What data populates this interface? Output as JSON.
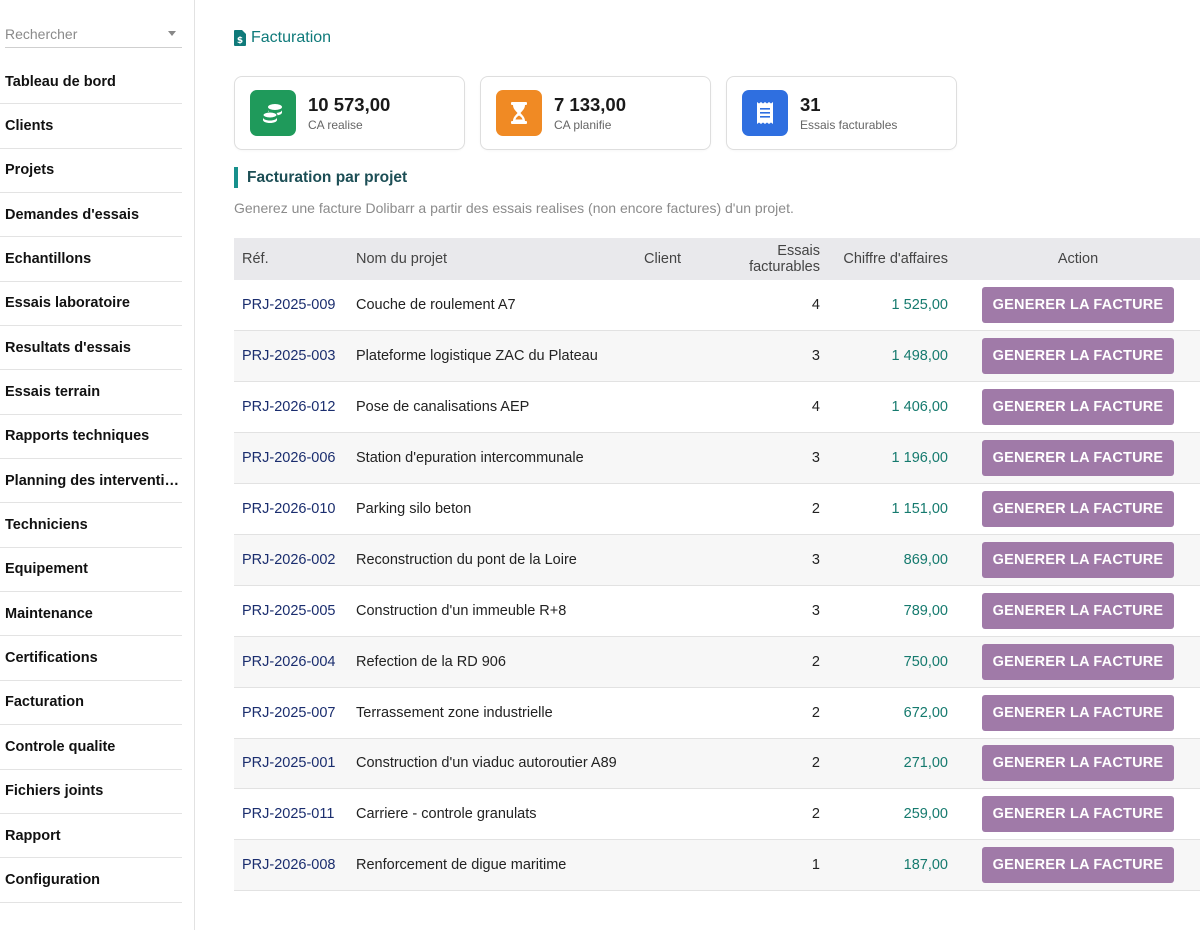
{
  "sidebar": {
    "search_placeholder": "Rechercher",
    "items": [
      {
        "label": "Tableau de bord"
      },
      {
        "label": "Clients"
      },
      {
        "label": "Projets"
      },
      {
        "label": "Demandes d'essais"
      },
      {
        "label": "Echantillons"
      },
      {
        "label": "Essais laboratoire"
      },
      {
        "label": "Resultats d'essais"
      },
      {
        "label": "Essais terrain"
      },
      {
        "label": "Rapports techniques"
      },
      {
        "label": "Planning des interventions"
      },
      {
        "label": "Techniciens"
      },
      {
        "label": "Equipement"
      },
      {
        "label": "Maintenance"
      },
      {
        "label": "Certifications"
      },
      {
        "label": "Facturation"
      },
      {
        "label": "Controle qualite"
      },
      {
        "label": "Fichiers joints"
      },
      {
        "label": "Rapport"
      },
      {
        "label": "Configuration"
      }
    ]
  },
  "header": {
    "title": "Facturation",
    "title_icon": "invoice-icon"
  },
  "cards": [
    {
      "value": "10 573,00",
      "label": "CA realise",
      "icon": "coins-icon",
      "color": "#1f9a5b"
    },
    {
      "value": "7 133,00",
      "label": "CA planifie",
      "icon": "hourglass-icon",
      "color": "#f08a24"
    },
    {
      "value": "31",
      "label": "Essais facturables",
      "icon": "receipt-icon",
      "color": "#2f6fe0"
    }
  ],
  "section": {
    "title": "Facturation par projet",
    "description": "Generez une facture Dolibarr a partir des essais realises (non encore factures) d'un projet."
  },
  "table": {
    "columns": {
      "ref": "Réf.",
      "name": "Nom du projet",
      "client": "Client",
      "count": "Essais facturables",
      "ca": "Chiffre d'affaires",
      "action": "Action"
    },
    "button_label": "GENERER LA FACTURE",
    "rows": [
      {
        "ref": "PRJ-2025-009",
        "name": "Couche de roulement A7",
        "client": "",
        "count": "4",
        "ca": "1 525,00"
      },
      {
        "ref": "PRJ-2025-003",
        "name": "Plateforme logistique ZAC du Plateau",
        "client": "",
        "count": "3",
        "ca": "1 498,00"
      },
      {
        "ref": "PRJ-2026-012",
        "name": "Pose de canalisations AEP",
        "client": "",
        "count": "4",
        "ca": "1 406,00"
      },
      {
        "ref": "PRJ-2026-006",
        "name": "Station d'epuration intercommunale",
        "client": "",
        "count": "3",
        "ca": "1 196,00"
      },
      {
        "ref": "PRJ-2026-010",
        "name": "Parking silo beton",
        "client": "",
        "count": "2",
        "ca": "1 151,00"
      },
      {
        "ref": "PRJ-2026-002",
        "name": "Reconstruction du pont de la Loire",
        "client": "",
        "count": "3",
        "ca": "869,00"
      },
      {
        "ref": "PRJ-2025-005",
        "name": "Construction d'un immeuble R+8",
        "client": "",
        "count": "3",
        "ca": "789,00"
      },
      {
        "ref": "PRJ-2026-004",
        "name": "Refection de la RD 906",
        "client": "",
        "count": "2",
        "ca": "750,00"
      },
      {
        "ref": "PRJ-2025-007",
        "name": "Terrassement zone industrielle",
        "client": "",
        "count": "2",
        "ca": "672,00"
      },
      {
        "ref": "PRJ-2025-001",
        "name": "Construction d'un viaduc autoroutier A89",
        "client": "",
        "count": "2",
        "ca": "271,00"
      },
      {
        "ref": "PRJ-2025-011",
        "name": "Carriere - controle granulats",
        "client": "",
        "count": "2",
        "ca": "259,00"
      },
      {
        "ref": "PRJ-2026-008",
        "name": "Renforcement de digue maritime",
        "client": "",
        "count": "1",
        "ca": "187,00"
      }
    ]
  }
}
